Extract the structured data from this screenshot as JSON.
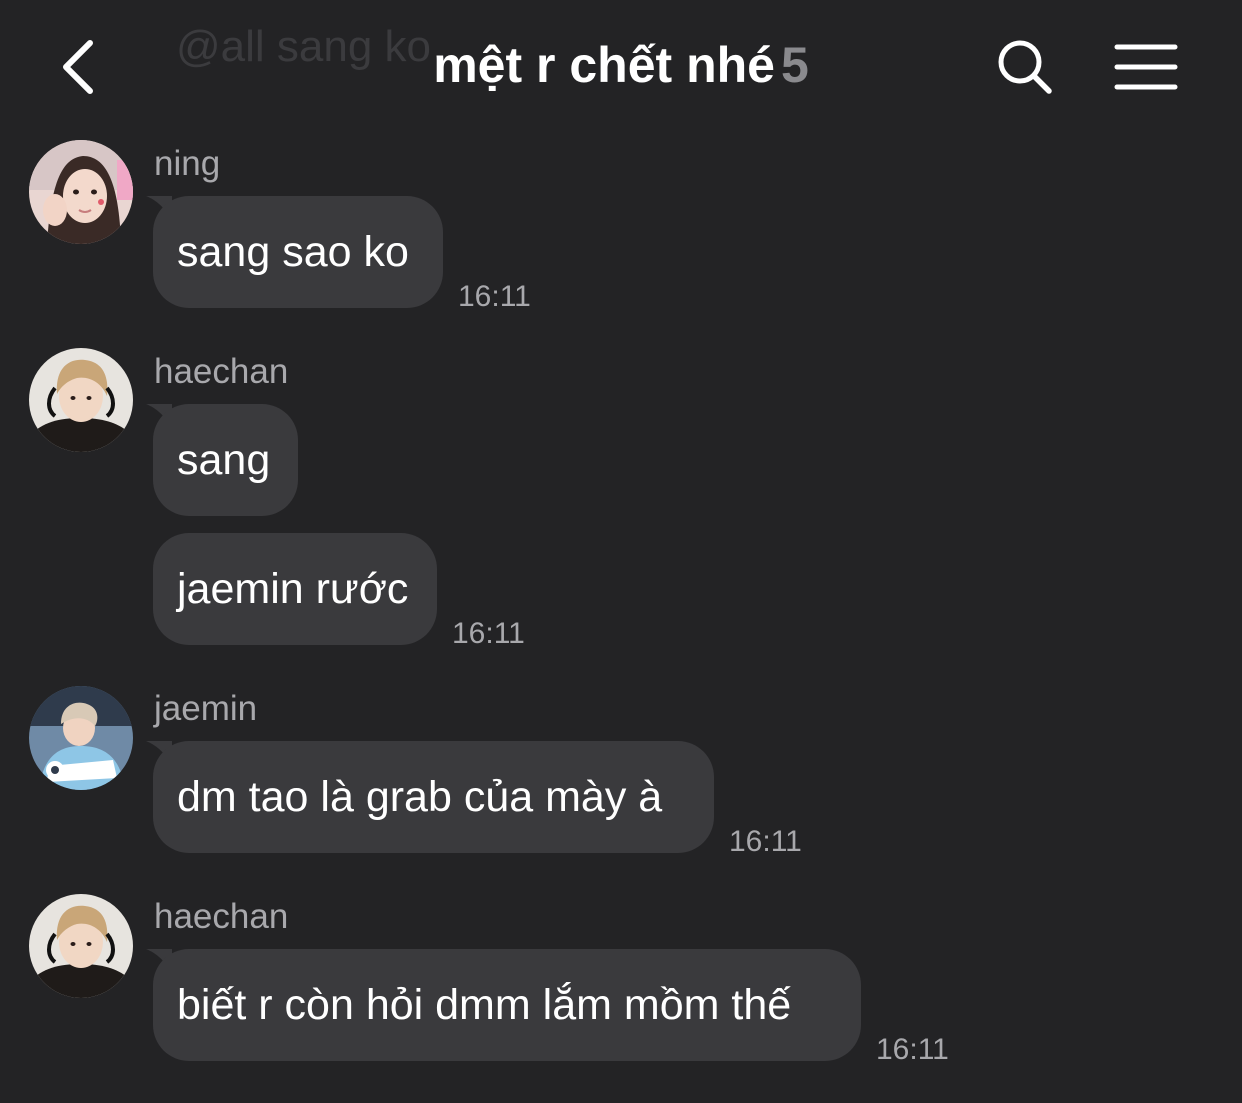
{
  "header": {
    "ghost_text": "@all sang ko",
    "title": "mệt r chết nhé",
    "member_count": "5",
    "back_icon": "chevron-left-icon",
    "search_icon": "search-icon",
    "menu_icon": "hamburger-menu-icon"
  },
  "colors": {
    "background": "#232325",
    "bubble": "#3a3a3d",
    "secondary_text": "#a8a8ac"
  },
  "messages": [
    {
      "sender": "ning",
      "bubbles": [
        "sang sao ko"
      ],
      "time": "16:11"
    },
    {
      "sender": "haechan",
      "bubbles": [
        "sang",
        "jaemin rước"
      ],
      "time": "16:11"
    },
    {
      "sender": "jaemin",
      "bubbles": [
        "dm tao là grab của mày à"
      ],
      "time": "16:11"
    },
    {
      "sender": "haechan",
      "bubbles": [
        "biết r còn hỏi dmm lắm mồm thế"
      ],
      "time": "16:11"
    }
  ]
}
